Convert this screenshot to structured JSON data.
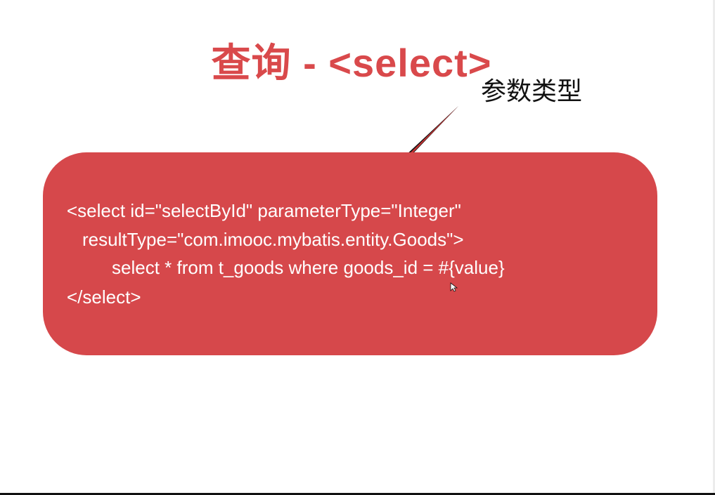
{
  "slide": {
    "title": "查询 - <select>",
    "callout": "参数类型",
    "code_lines": [
      "<select id=\"selectById\" parameterType=\"Integer\"",
      "resultType=\"com.imooc.mybatis.entity.Goods\">",
      "select * from t_goods where goods_id = #{value}",
      "</select>"
    ]
  },
  "colors": {
    "accent": "#d9494b",
    "box": "#d6484b",
    "code_text": "#ffffff",
    "callout_text": "#111111"
  },
  "icons": {
    "arrow": "arrow-icon",
    "cursor": "mouse-cursor-icon"
  }
}
